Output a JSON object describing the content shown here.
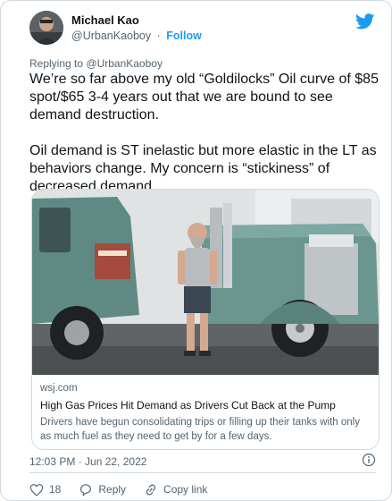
{
  "author": {
    "name": "Michael Kao",
    "handle": "@UrbanKaoboy",
    "separator": "·",
    "follow_label": "Follow"
  },
  "replying": {
    "prefix": "Replying to",
    "handle": "@UrbanKaoboy"
  },
  "tweet": {
    "text": "We’re so far above my old “Goldilocks” Oil curve of $85 spot/$65 3-4 years out that we are bound to see demand destruction.\n\nOil demand is ST inelastic but more elastic in the LT as behaviors change. My concern is “stickiness” of decreased demand."
  },
  "link_card": {
    "domain": "wsj.com",
    "headline": "High Gas Prices Hit Demand as Drivers Cut Back at the Pump",
    "description": "Drivers have begun consolidating trips or filling up their tanks with only as much fuel as they need to get by for a few days."
  },
  "meta": {
    "timestamp": "12:03 PM · Jun 22, 2022"
  },
  "actions": {
    "like_count": "18",
    "reply_label": "Reply",
    "copy_link_label": "Copy link"
  },
  "icons": {
    "brand": "twitter-bird-icon",
    "info": "info-icon",
    "like": "heart-icon",
    "reply": "reply-bubble-icon",
    "copy": "link-icon"
  },
  "colors": {
    "accent": "#1d9bf0",
    "text": "#0f1419",
    "muted": "#536471",
    "border": "#cfd9de"
  }
}
